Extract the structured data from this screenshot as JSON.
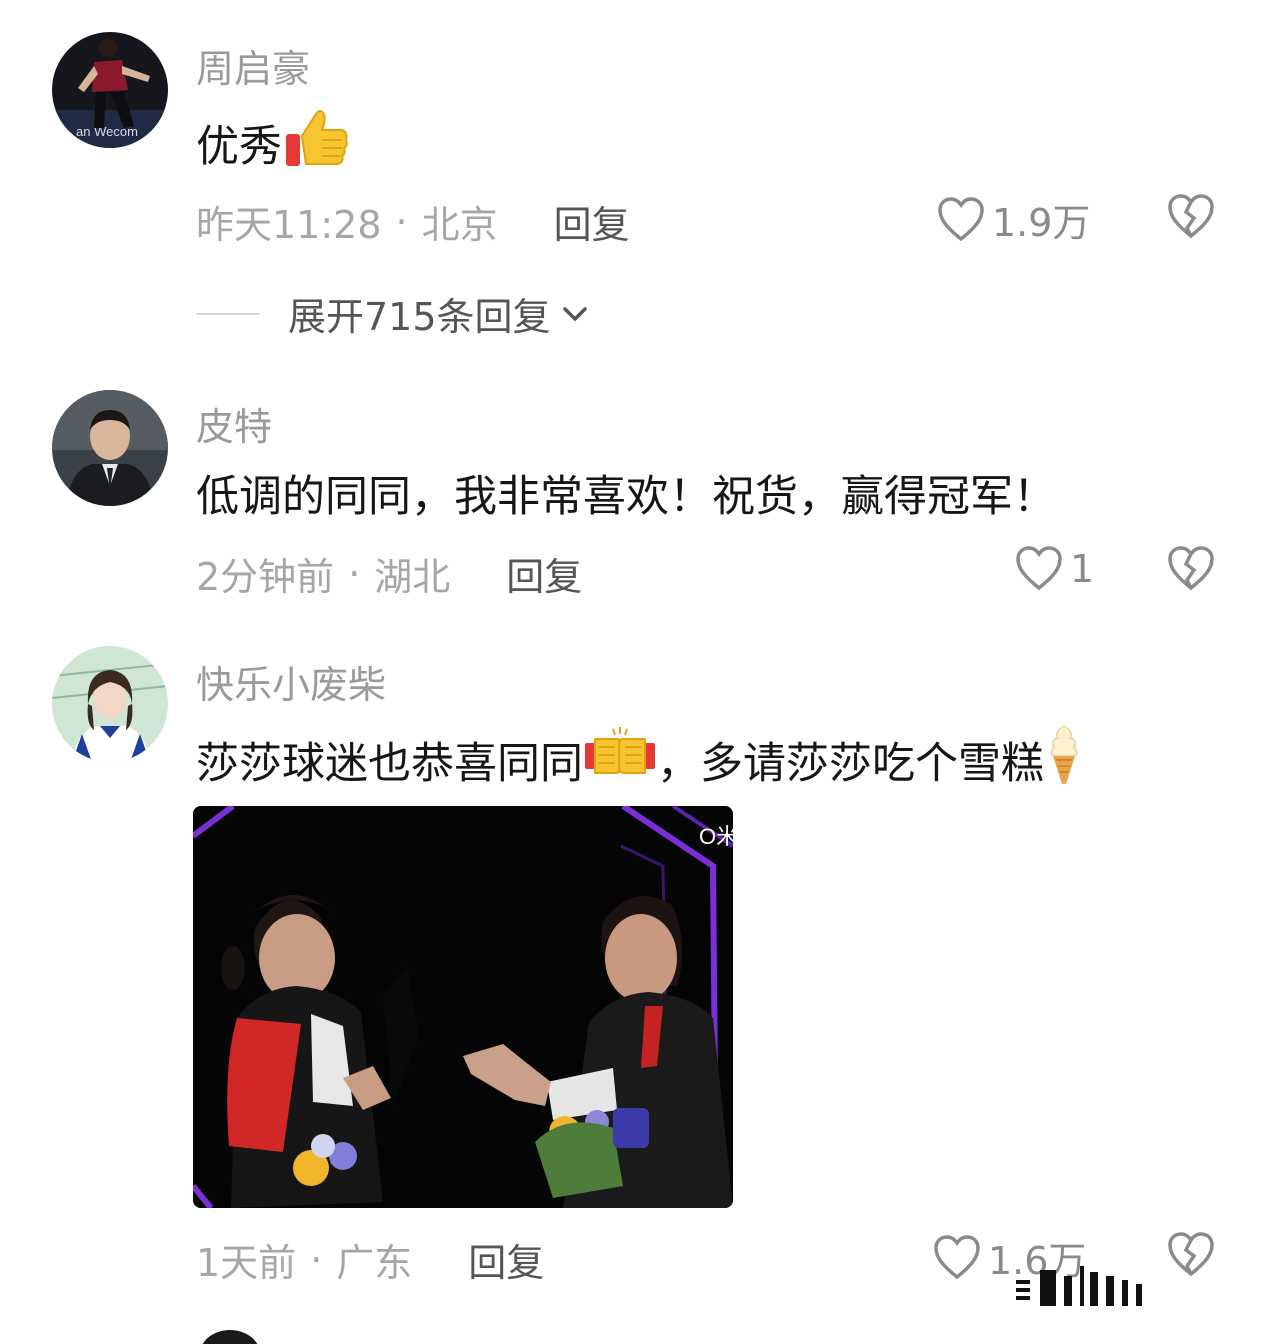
{
  "comments": [
    {
      "username": "周启豪",
      "text": "优秀",
      "emoji_icon": "thumbs-up-icon",
      "time": "昨天11:28",
      "location": "北京",
      "reply_label": "回复",
      "likes": "1.9万"
    },
    {
      "username": "皮特",
      "text": "低调的同同，我非常喜欢！祝货，赢得冠军！",
      "time": "2分钟前",
      "location": "湖北",
      "reply_label": "回复",
      "likes": "1"
    },
    {
      "username": "快乐小废柴",
      "text_part1": "莎莎球迷也恭喜同同",
      "text_part2": "，多请莎莎吃个雪糕",
      "emoji_icons": [
        "fist-bump-icon",
        "ice-cream-icon"
      ],
      "image_text": "O米",
      "time": "1天前",
      "location": "广东",
      "reply_label": "回复",
      "likes": "1.6万"
    }
  ],
  "expand_replies": "展开715条回复",
  "separator": "·",
  "colors": {
    "meta": "#a6a6a6",
    "username": "#9a9a9a",
    "text": "#161616",
    "photo_frame": "#7b2fd6"
  }
}
